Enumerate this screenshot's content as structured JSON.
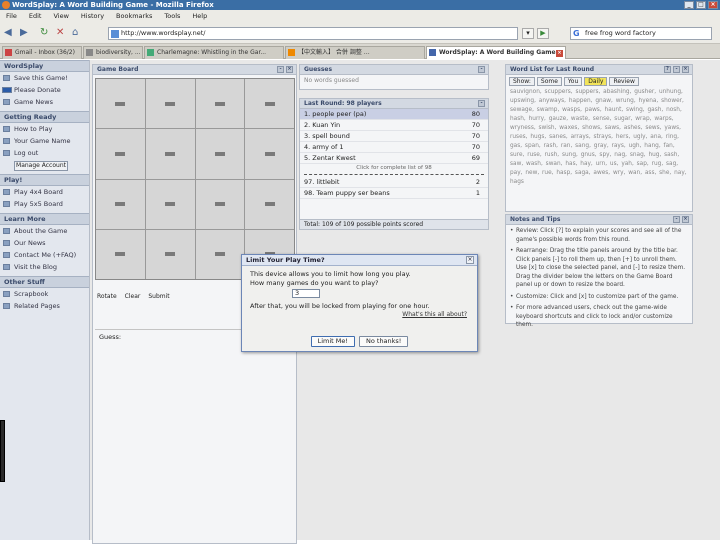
{
  "window": {
    "title": "WordSplay: A Word Building Game - Mozilla Firefox"
  },
  "menu": [
    "File",
    "Edit",
    "View",
    "History",
    "Bookmarks",
    "Tools",
    "Help"
  ],
  "nav": {
    "url": "http://www.wordsplay.net/",
    "search": "free frog word factory"
  },
  "tabs": [
    {
      "label": "Gmail - Inbox (36/2)"
    },
    {
      "label": "biodiversity, ..."
    },
    {
      "label": "Charlemagne: Whistling in the Gar..."
    },
    {
      "label": "【中文輸入】 合併 調整 …"
    },
    {
      "label": "WordSplay: A Word Building Game"
    }
  ],
  "sidebar": {
    "wordsplay_header": "WordSplay",
    "items1": [
      "Save this Game!",
      "Please Donate",
      "Game News"
    ],
    "ready_header": "Getting Ready",
    "items2": [
      "How to Play",
      "Your Game Name",
      "Log out"
    ],
    "manage_btn": "Manage Account",
    "play_header": "Play!",
    "items3": [
      "Play 4x4 Board",
      "Play 5x5 Board"
    ],
    "learn_header": "Learn More",
    "items4": [
      "About the Game",
      "Our News",
      "Contact Me (+FAQ)",
      "Visit the Blog"
    ],
    "other_header": "Other Stuff",
    "items5": [
      "Scrapbook",
      "Related Pages"
    ]
  },
  "board": {
    "header": "Game Board",
    "footer": [
      "Rotate",
      "Clear",
      "Submit"
    ],
    "guess_label": "Guess:"
  },
  "guesses": {
    "header": "Guesses",
    "empty": "No words guessed"
  },
  "last_round": {
    "header": "Last Round: 98 players",
    "rows": [
      {
        "name": "1. people peer (pa)",
        "score": "80"
      },
      {
        "name": "2. Kuan Yin",
        "score": "70"
      },
      {
        "name": "3. spell bound",
        "score": "70"
      },
      {
        "name": "4. army of 1",
        "score": "70"
      },
      {
        "name": "5. Zentar Kwest",
        "score": "69"
      }
    ],
    "between": "Click for complete list of 98",
    "rows2": [
      {
        "name": "97. littlebit",
        "score": "2"
      },
      {
        "name": "98. Team puppy ser beans",
        "score": "1"
      }
    ],
    "footer": "Total: 109 of 109 possible points scored"
  },
  "wordlist": {
    "header": "Word List for Last Round",
    "filters": [
      "Show:",
      "Some",
      "You",
      "Daily",
      "Review"
    ],
    "words": "sauvignon, scuppers, suppers, abashing, gusher, unhung, upswing, anyways, happen, gnaw, wrung, hyena, shower, sewage, swamp, wasps, paws, haunt, swing, gash, nosh, hash, hurry, gauze, waste, sense, sugar, wrap, warps, wryness, swish, waxes, shows, saws, ashes, sews, yaws, ruses, hugs, sanes, arrays, strays, hers, ugly, ana, ring, gas, span, rash, ran, sang, gray, rays, ugh, hang, fan, sure, ruse, rush, sung, gnus, spy, nag, snag, hug, sash, saw, wash, swan, has, hay, urn, us, yah, sap, rug, sag, pay, new, rue, hasp, saga, awes, wry, wan, ass, she, nay, hags"
  },
  "notes": {
    "header": "Notes and Tips",
    "tips": [
      "Review: Click [?] to explain your scores and see all of the game's possible words from this round.",
      "Rearrange: Drag the title panels around by the title bar. Click panels [-] to roll them up, then [+] to unroll them. Use [x] to close the selected panel, and [-] to resize them. Drag the divider below the letters on the Game Board panel up or down to resize the board.",
      "Customize: Click and [x] to customize part of the game.",
      "For more advanced users, check out the game-wide keyboard shortcuts and click to lock and/or customize them."
    ]
  },
  "dialog": {
    "title": "Limit Your Play Time?",
    "line1": "This device allows you to limit how long you play.",
    "line2": "How many games do you want to play?",
    "value": "3",
    "line3": "After that, you will be locked from playing for one hour.",
    "link": "What's this all about?",
    "ok": "Limit Me!",
    "cancel": "No thanks!"
  }
}
